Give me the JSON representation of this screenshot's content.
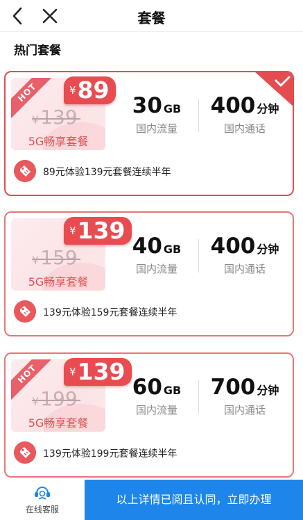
{
  "header": {
    "title": "套餐"
  },
  "section": {
    "title": "热门套餐"
  },
  "plans": [
    {
      "hot": "HOT",
      "currency": "¥",
      "new_price": "89",
      "old_price": "139",
      "name": "5G畅享套餐",
      "data_value": "30",
      "data_unit": "GB",
      "data_label": "国内流量",
      "call_value": "400",
      "call_unit": "分钟",
      "call_label": "国内通话",
      "desc": "89元体验139元套餐连续半年",
      "selected": true
    },
    {
      "hot": "",
      "currency": "¥",
      "new_price": "139",
      "old_price": "159",
      "name": "5G畅享套餐",
      "data_value": "40",
      "data_unit": "GB",
      "data_label": "国内流量",
      "call_value": "400",
      "call_unit": "分钟",
      "call_label": "国内通话",
      "desc": "139元体验159元套餐连续半年",
      "selected": false
    },
    {
      "hot": "HOT",
      "currency": "¥",
      "new_price": "139",
      "old_price": "199",
      "name": "5G畅享套餐",
      "data_value": "60",
      "data_unit": "GB",
      "data_label": "国内流量",
      "call_value": "700",
      "call_unit": "分钟",
      "call_label": "国内通话",
      "desc": "139元体验199元套餐连续半年",
      "selected": false
    }
  ],
  "bottom": {
    "service_label": "在线客服",
    "submit_label": "以上详情已阅且认同，立即办理"
  },
  "colors": {
    "accent_red": "#e94c50",
    "primary_blue": "#1e86ea"
  }
}
